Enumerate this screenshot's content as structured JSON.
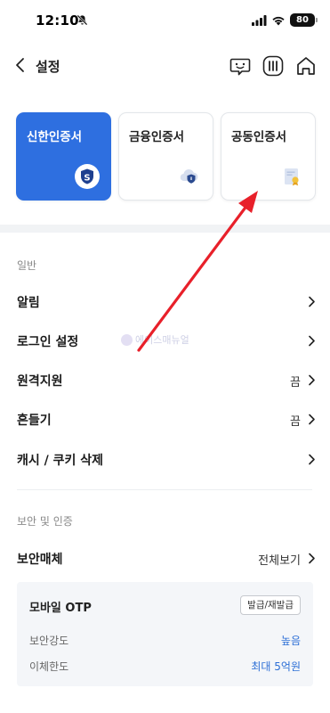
{
  "status_bar": {
    "time": "12:10",
    "battery": "80"
  },
  "header": {
    "title": "설정"
  },
  "certificates": [
    {
      "label": "신한인증서",
      "active": true,
      "icon": "shinhan-s-shield-icon"
    },
    {
      "label": "금융인증서",
      "active": false,
      "icon": "cloud-shield-icon"
    },
    {
      "label": "공동인증서",
      "active": false,
      "icon": "certificate-document-icon"
    }
  ],
  "general": {
    "title": "일반",
    "items": [
      {
        "label": "알림",
        "value": ""
      },
      {
        "label": "로그인 설정",
        "value": ""
      },
      {
        "label": "원격지원",
        "value": "끔"
      },
      {
        "label": "흔들기",
        "value": "끔"
      },
      {
        "label": "캐시 / 쿠키 삭제",
        "value": ""
      }
    ]
  },
  "security": {
    "title": "보안 및 인증",
    "media_label": "보안매체",
    "media_action": "전체보기",
    "otp": {
      "title": "모바일 OTP",
      "button": "발급/재발급",
      "rows": [
        {
          "label": "보안강도",
          "value": "높음"
        },
        {
          "label": "이체한도",
          "value": "최대 5억원"
        }
      ]
    }
  },
  "watermark": {
    "text": "에이스매뉴얼"
  },
  "colors": {
    "accent": "#2e6fe0",
    "link": "#2d6fd6",
    "annotation_arrow": "#e8202a"
  }
}
